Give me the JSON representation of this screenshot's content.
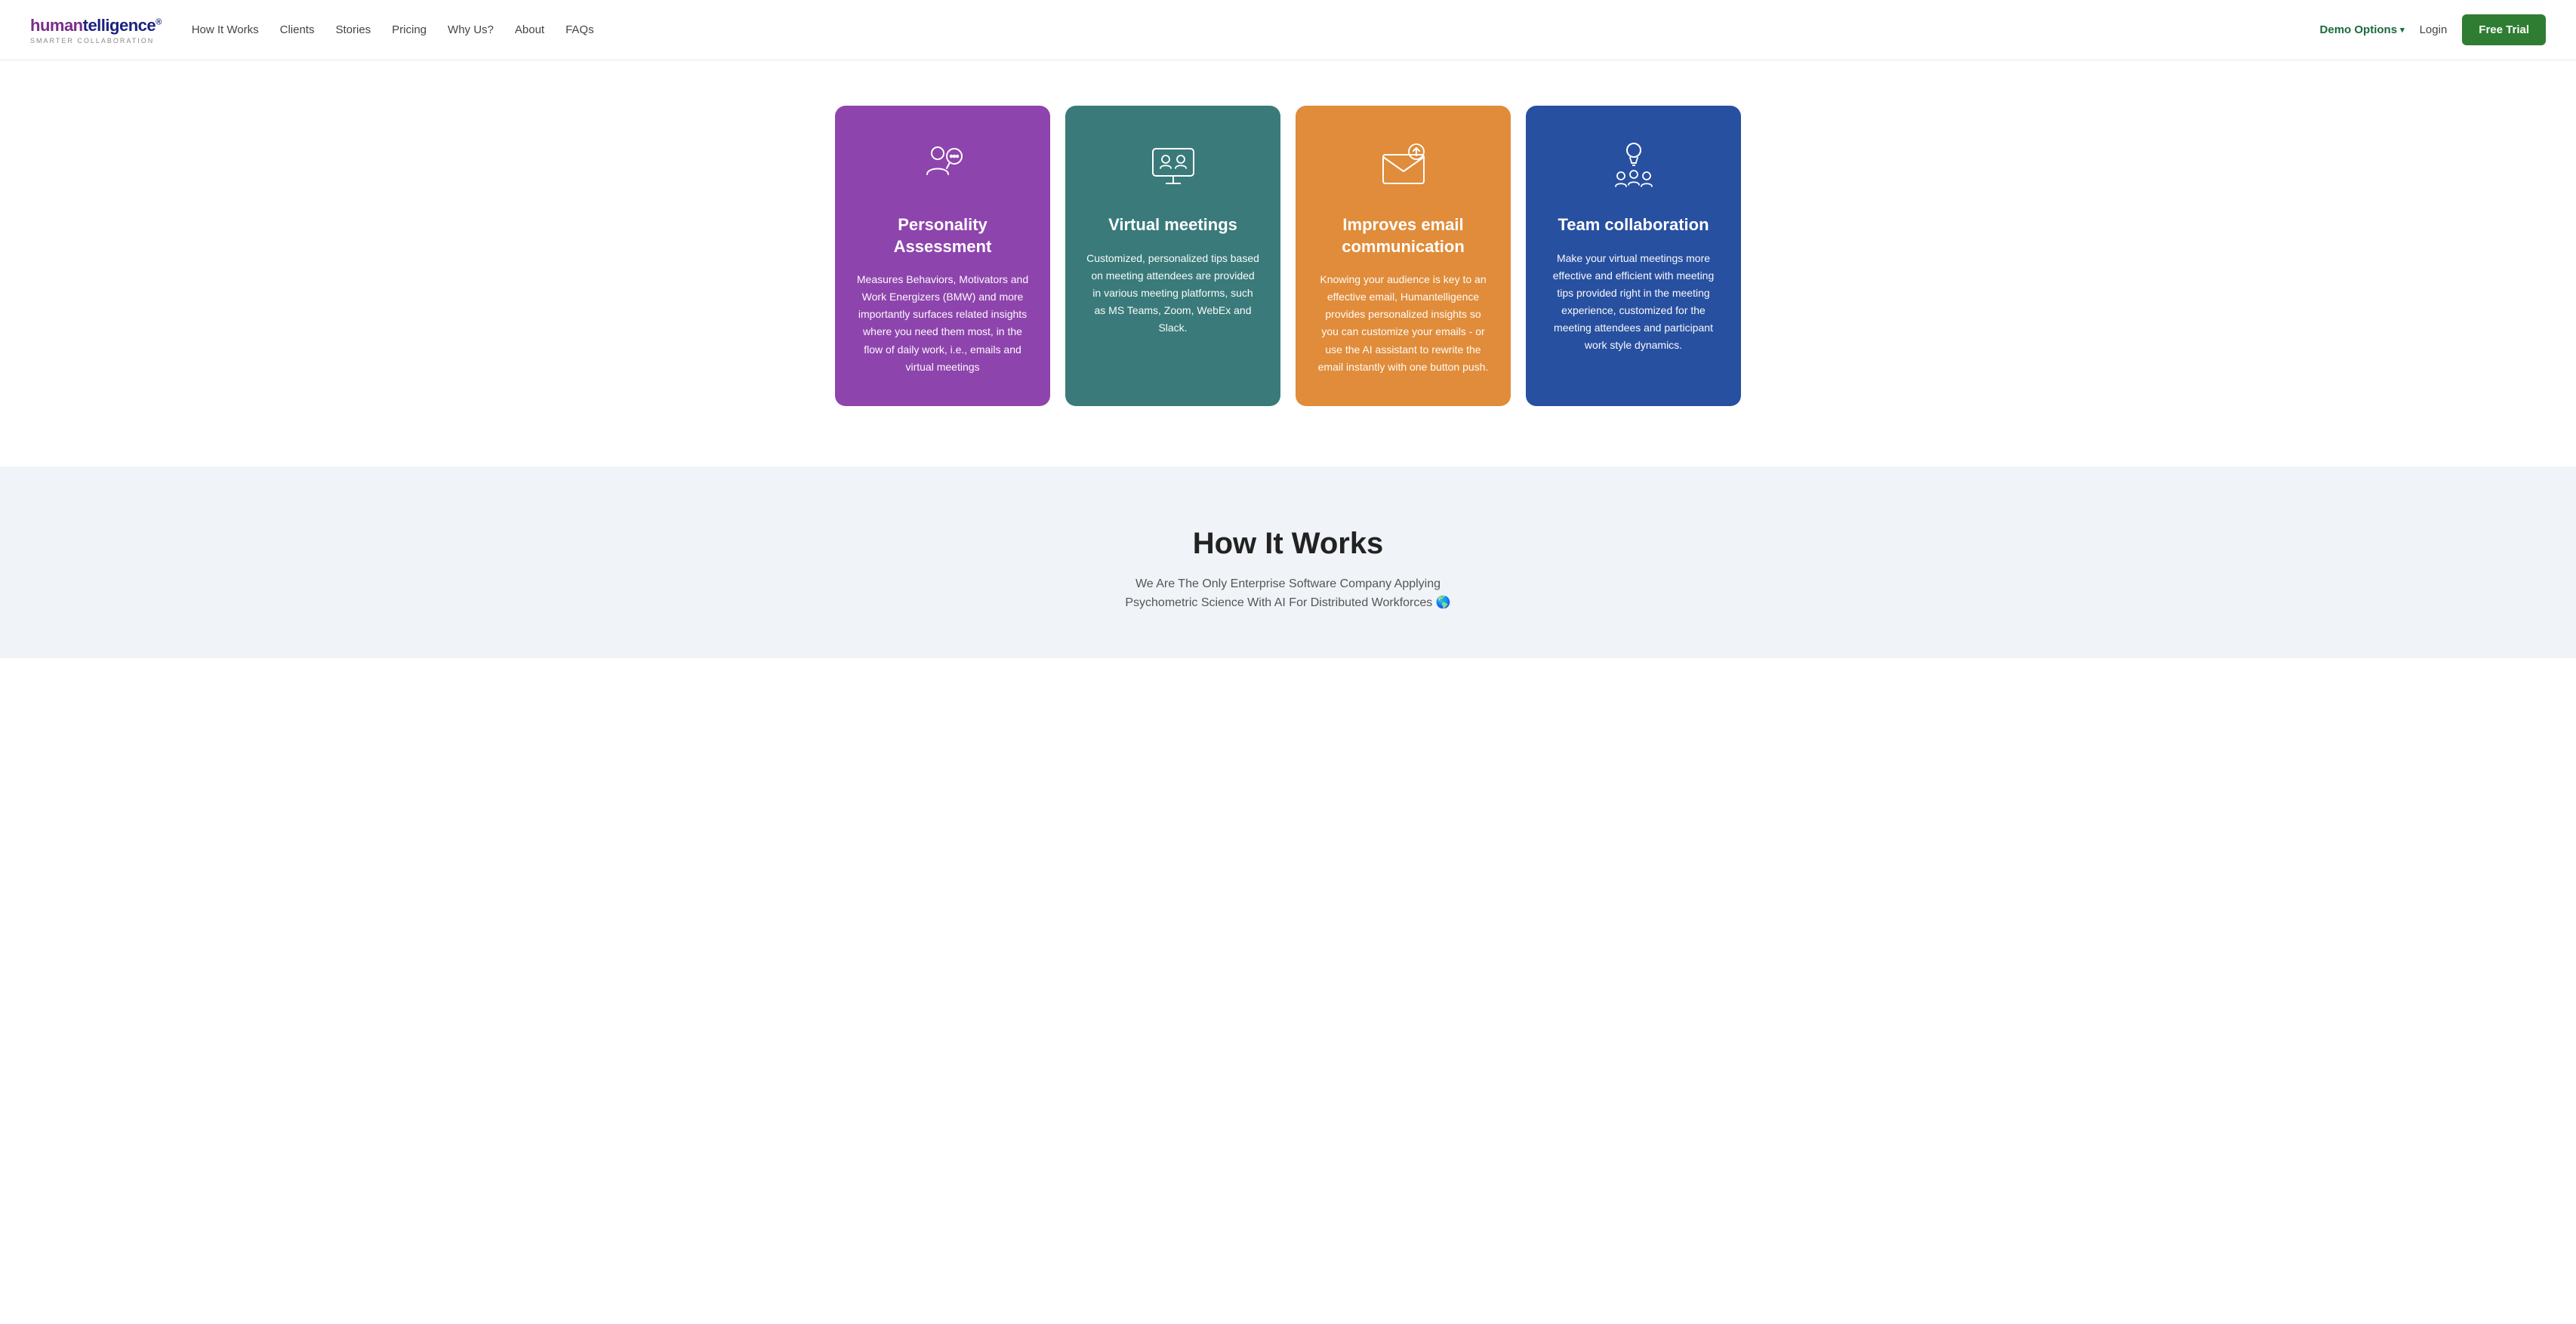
{
  "logo": {
    "human": "human",
    "telligence": "telligence",
    "tagline": "SMARTER COLLABORATION",
    "trademark": "®"
  },
  "nav": {
    "links": [
      {
        "label": "How It Works",
        "id": "how-it-works"
      },
      {
        "label": "Clients",
        "id": "clients"
      },
      {
        "label": "Stories",
        "id": "stories"
      },
      {
        "label": "Pricing",
        "id": "pricing"
      },
      {
        "label": "Why Us?",
        "id": "why-us"
      },
      {
        "label": "About",
        "id": "about"
      },
      {
        "label": "FAQs",
        "id": "faqs"
      }
    ],
    "demo_options": "Demo Options",
    "login": "Login",
    "free_trial": "Free Trial"
  },
  "cards": [
    {
      "id": "personality",
      "color": "card-purple",
      "title": "Personality Assessment",
      "description": "Measures Behaviors, Motivators and Work Energizers (BMW) and more importantly surfaces related insights where you need them most, in the flow of daily work, i.e., emails and virtual meetings",
      "icon": "personality-icon"
    },
    {
      "id": "virtual-meetings",
      "color": "card-teal",
      "title": "Virtual meetings",
      "description": "Customized, personalized tips based on meeting attendees are provided in various meeting platforms, such as MS Teams, Zoom, WebEx and Slack.",
      "icon": "virtual-meetings-icon"
    },
    {
      "id": "email",
      "color": "card-orange",
      "title": "Improves email communication",
      "description": "Knowing your audience is key to an effective email, Humantelligence provides personalized insights so you can customize your emails - or use the AI assistant to rewrite the email instantly with one button push.",
      "icon": "email-icon"
    },
    {
      "id": "team",
      "color": "card-blue",
      "title": "Team collaboration",
      "description": "Make your virtual meetings more effective and efficient with meeting tips provided right in the meeting experience, customized for the meeting attendees and participant work style dynamics.",
      "icon": "team-icon"
    }
  ],
  "how_section": {
    "title": "How It Works",
    "subtitle_line1": "We Are The Only Enterprise Software Company Applying",
    "subtitle_line2": "Psychometric Science With AI For Distributed Workforces 🌎"
  }
}
